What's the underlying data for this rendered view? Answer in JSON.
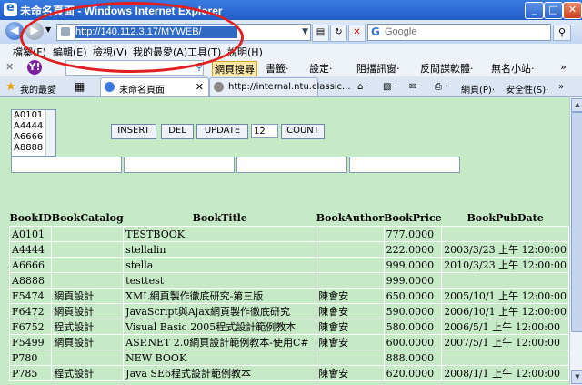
{
  "window": {
    "title": "未命名頁面 - Windows Internet Explorer",
    "min_glyph": "_",
    "max_glyph": "□",
    "close_glyph": "✕"
  },
  "address": {
    "url": "http://140.112.3.17/MYWEB/",
    "search_placeholder": "Google"
  },
  "menu": {
    "items": [
      "檔案(F)",
      "編輯(E)",
      "檢視(V)",
      "我的最愛(A)",
      "工具(T)",
      "說明(H)"
    ]
  },
  "yahoo_toolbar": {
    "logo": "Y!",
    "search_button": "網頁搜尋",
    "items": [
      "書籤·",
      "設定·",
      "阻擋訊窗·",
      "反間諜軟體·",
      "無名小站·"
    ]
  },
  "tabs": {
    "favorites_label": "我的最愛",
    "items": [
      {
        "label": "未命名頁面",
        "close": "✕"
      },
      {
        "label": "http://internal.ntu.classic...",
        "close": ""
      }
    ],
    "commands": [
      "網頁(P)·",
      "安全性(S)·"
    ]
  },
  "page": {
    "list_options": [
      "A0101",
      "A4444",
      "A6666",
      "A8888"
    ],
    "buttons": {
      "insert": "INSERT",
      "del": "DEL",
      "update": "UPDATE",
      "count": "COUNT"
    },
    "count_value": "12",
    "table": {
      "headers": [
        "BookID",
        "BookCatalog",
        "BookTitle",
        "BookAuthor",
        "BookPrice",
        "BookPubDate"
      ],
      "rows": [
        [
          "A0101",
          "",
          "TESTBOOK",
          "",
          "777.0000",
          ""
        ],
        [
          "A4444",
          "",
          "stellalin",
          "",
          "222.0000",
          "2003/3/23 上午 12:00:00"
        ],
        [
          "A6666",
          "",
          "stella",
          "",
          "999.0000",
          "2010/3/23 上午 12:00:00"
        ],
        [
          "A8888",
          "",
          "testtest",
          "",
          "999.0000",
          ""
        ],
        [
          "F5474",
          "網頁設計",
          "XML網頁製作徹底研究-第三版",
          "陳會安",
          "650.0000",
          "2005/10/1 上午 12:00:00"
        ],
        [
          "F6472",
          "網頁設計",
          "JavaScript與Ajax網頁製作徹底研究",
          "陳會安",
          "590.0000",
          "2006/10/1 上午 12:00:00"
        ],
        [
          "F6752",
          "程式設計",
          "Visual Basic 2005程式設計範例教本",
          "陳會安",
          "580.0000",
          "2006/5/1 上午 12:00:00"
        ],
        [
          "F5499",
          "網頁設計",
          "ASP.NET 2.0網頁設計範例教本-使用C#",
          "陳會安",
          "600.0000",
          "2007/5/1 上午 12:00:00"
        ],
        [
          "P780",
          "",
          "NEW BOOK",
          "",
          "888.0000",
          ""
        ],
        [
          "P785",
          "程式設計",
          "Java SE6程式設計範例教本",
          "陳會安",
          "620.0000",
          "2008/1/1 上午 12:00:00"
        ]
      ]
    }
  }
}
